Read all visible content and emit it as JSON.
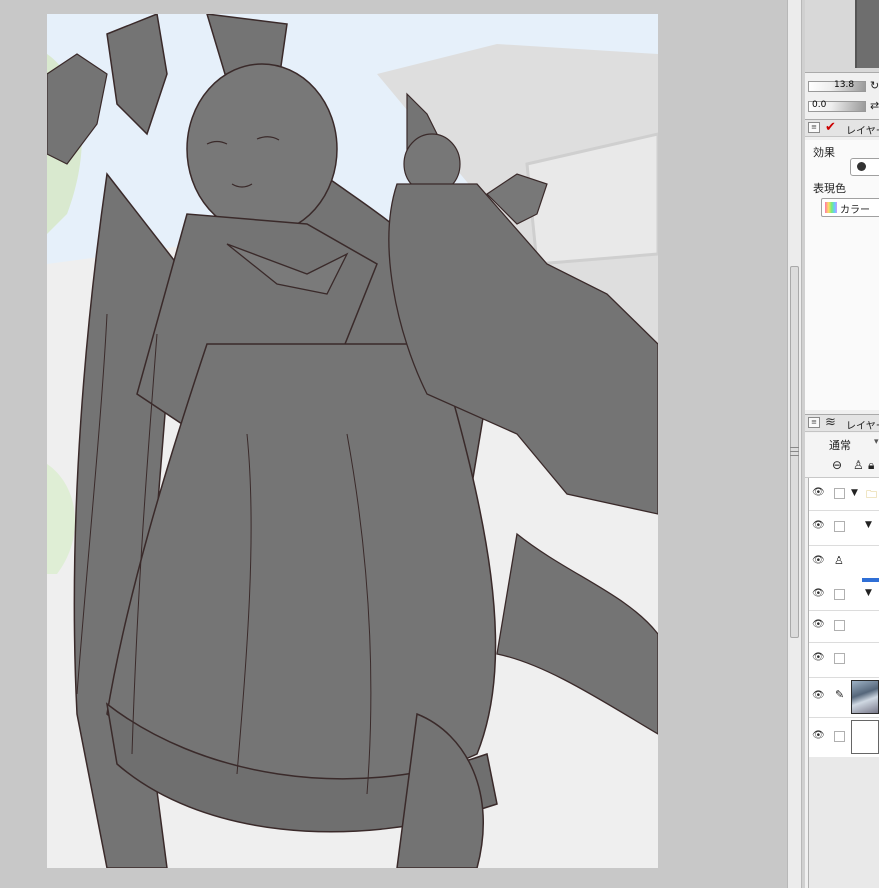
{
  "canvas": {
    "background_color": "#c8c8c8",
    "artboard_note_colors": {
      "sky": "#e7f1fb",
      "lineart_fill": "#777777",
      "line": "#3a2a2a"
    }
  },
  "navigator": {
    "brush_size_value": "13.8",
    "opacity_value": "0.0"
  },
  "properties_panel": {
    "title": "レイヤープ",
    "effect_label": "効果",
    "expression_color_label": "表現色",
    "color_button_label": "カラー"
  },
  "layers_panel": {
    "title": "レイヤー",
    "blend_mode": "通常",
    "layers": [
      {
        "type": "folder",
        "expanded": true
      },
      {
        "type": "folder",
        "expanded": true
      },
      {
        "type": "raster",
        "icon": "reference-person-icon"
      },
      {
        "type": "folder",
        "expanded": true
      },
      {
        "type": "raster"
      },
      {
        "type": "raster"
      },
      {
        "type": "image",
        "icon": "pen-icon"
      },
      {
        "type": "paper"
      }
    ]
  },
  "icons": {
    "panel_menu": "panel-menu-icon",
    "properties": "layer-property-icon",
    "layers": "layer-stack-icon",
    "visibility": "eye-icon",
    "folder": "folder-icon"
  }
}
